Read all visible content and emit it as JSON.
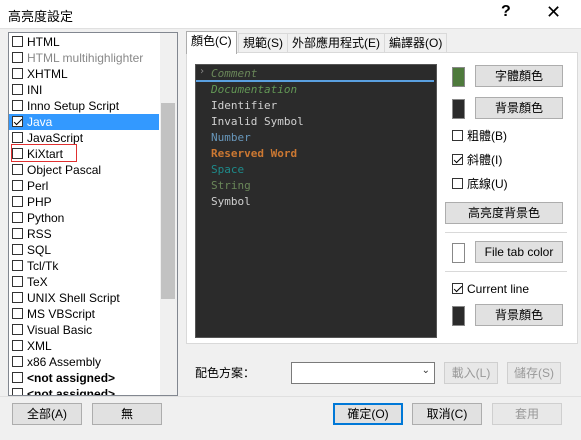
{
  "window": {
    "title": "高亮度設定",
    "help": "?",
    "close": "✕"
  },
  "languages": [
    {
      "label": "HTML",
      "checked": false,
      "disabled": false,
      "bold": false,
      "selected": false
    },
    {
      "label": "HTML multihighlighter",
      "checked": false,
      "disabled": true,
      "bold": false,
      "selected": false
    },
    {
      "label": "XHTML",
      "checked": false,
      "disabled": false,
      "bold": false,
      "selected": false
    },
    {
      "label": "INI",
      "checked": false,
      "disabled": false,
      "bold": false,
      "selected": false
    },
    {
      "label": "Inno Setup Script",
      "checked": false,
      "disabled": false,
      "bold": false,
      "selected": false
    },
    {
      "label": "Java",
      "checked": true,
      "disabled": false,
      "bold": false,
      "selected": true
    },
    {
      "label": "JavaScript",
      "checked": false,
      "disabled": false,
      "bold": false,
      "selected": false
    },
    {
      "label": "KiXtart",
      "checked": false,
      "disabled": false,
      "bold": false,
      "selected": false
    },
    {
      "label": "Object Pascal",
      "checked": false,
      "disabled": false,
      "bold": false,
      "selected": false
    },
    {
      "label": "Perl",
      "checked": false,
      "disabled": false,
      "bold": false,
      "selected": false
    },
    {
      "label": "PHP",
      "checked": false,
      "disabled": false,
      "bold": false,
      "selected": false
    },
    {
      "label": "Python",
      "checked": false,
      "disabled": false,
      "bold": false,
      "selected": false
    },
    {
      "label": "RSS",
      "checked": false,
      "disabled": false,
      "bold": false,
      "selected": false
    },
    {
      "label": "SQL",
      "checked": false,
      "disabled": false,
      "bold": false,
      "selected": false
    },
    {
      "label": "Tcl/Tk",
      "checked": false,
      "disabled": false,
      "bold": false,
      "selected": false
    },
    {
      "label": "TeX",
      "checked": false,
      "disabled": false,
      "bold": false,
      "selected": false
    },
    {
      "label": "UNIX Shell Script",
      "checked": false,
      "disabled": false,
      "bold": false,
      "selected": false
    },
    {
      "label": "MS VBScript",
      "checked": false,
      "disabled": false,
      "bold": false,
      "selected": false
    },
    {
      "label": "Visual Basic",
      "checked": false,
      "disabled": false,
      "bold": false,
      "selected": false
    },
    {
      "label": "XML",
      "checked": false,
      "disabled": false,
      "bold": false,
      "selected": false
    },
    {
      "label": "x86 Assembly",
      "checked": false,
      "disabled": false,
      "bold": false,
      "selected": false
    },
    {
      "label": "<not assigned>",
      "checked": false,
      "disabled": false,
      "bold": true,
      "selected": false
    },
    {
      "label": "<not assigned>",
      "checked": false,
      "disabled": false,
      "bold": true,
      "selected": false
    }
  ],
  "tabs": [
    {
      "label": "顏色(C)",
      "active": true
    },
    {
      "label": "規範(S)",
      "active": false
    },
    {
      "label": "外部應用程式(E)",
      "active": false
    },
    {
      "label": "編譯器(O)",
      "active": false
    }
  ],
  "preview_items": [
    {
      "text": "Comment",
      "color": "#6a8759",
      "italic": true,
      "bold": false
    },
    {
      "text": "Documentation",
      "color": "#629755",
      "italic": true,
      "bold": false
    },
    {
      "text": "Identifier",
      "color": "#d0d0d0",
      "italic": false,
      "bold": false
    },
    {
      "text": "Invalid Symbol",
      "color": "#d0d0d0",
      "italic": false,
      "bold": false
    },
    {
      "text": "Number",
      "color": "#6897bb",
      "italic": false,
      "bold": false
    },
    {
      "text": "Reserved Word",
      "color": "#cc7832",
      "italic": false,
      "bold": true
    },
    {
      "text": "Space",
      "color": "#1e8a8a",
      "italic": false,
      "bold": false
    },
    {
      "text": "String",
      "color": "#6a8759",
      "italic": false,
      "bold": false
    },
    {
      "text": "Symbol",
      "color": "#d0d0d0",
      "italic": false,
      "bold": false
    }
  ],
  "preview_arrow": "›",
  "style_panel": {
    "fg_color": "#4e7a3c",
    "bg_color": "#2b2b2b",
    "fg_button": "字體顏色",
    "bg_button": "背景顏色",
    "bold_label": "粗體(B)",
    "bold_checked": false,
    "italic_label": "斜體(I)",
    "italic_checked": true,
    "underline_label": "底線(U)",
    "underline_checked": false,
    "highlight_bg_button": "高亮度背景色",
    "file_tab_color": "#ffffff",
    "file_tab_button": "File tab color",
    "current_line_label": "Current line",
    "current_line_checked": true,
    "current_line_bg_color": "#2b2b2b",
    "current_line_bg_button": "背景顏色"
  },
  "scheme": {
    "label": "配色方案：",
    "value": "",
    "load_button": "載入(L)",
    "save_button": "儲存(S)"
  },
  "footer": {
    "all_button": "全部(A)",
    "none_button": "無",
    "ok_button": "確定(O)",
    "cancel_button": "取消(C)",
    "apply_button": "套用"
  }
}
